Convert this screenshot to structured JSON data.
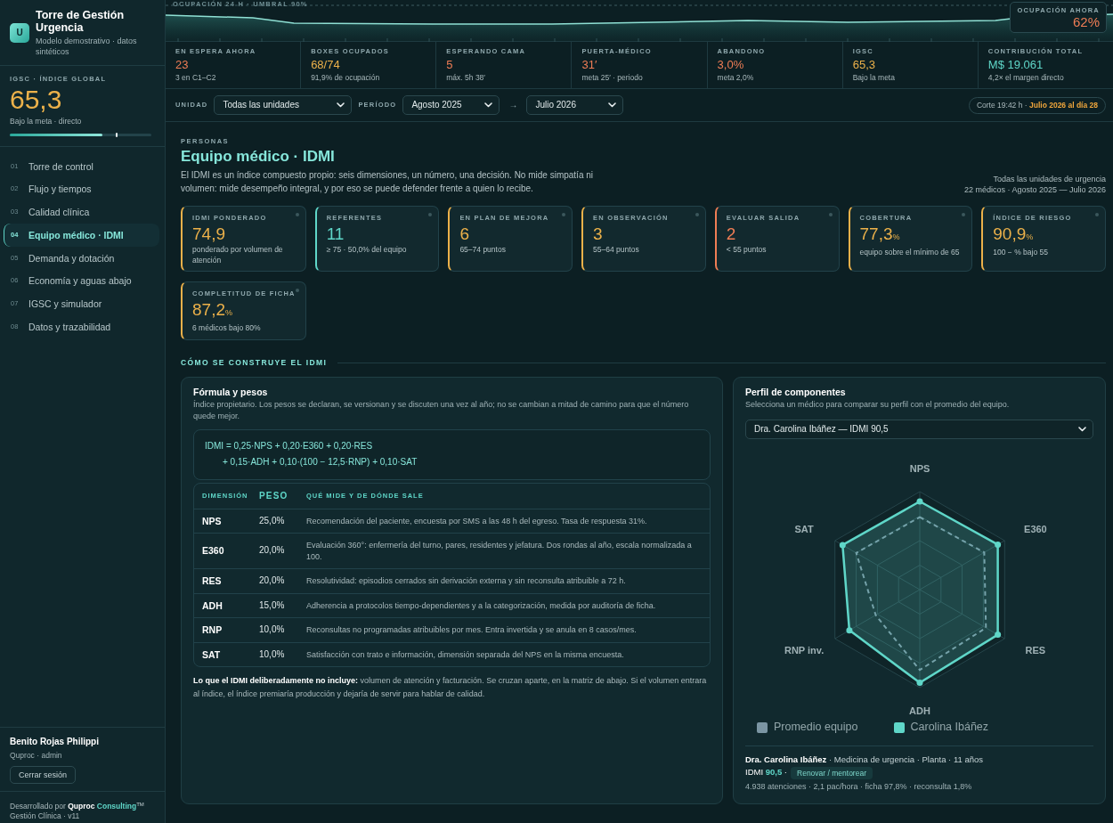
{
  "sidebar": {
    "logo": "U",
    "title": "Torre de Gestión Urgencia",
    "subtitle": "Modelo demostrativo · datos sintéticos",
    "index": {
      "label": "IGSC · ÍNDICE GLOBAL",
      "value": "65,3",
      "note": "Bajo la meta · directo",
      "level": 0.653
    },
    "nav": [
      {
        "number": "01",
        "label": "Torre de control",
        "selected": false
      },
      {
        "number": "02",
        "label": "Flujo y tiempos",
        "selected": false
      },
      {
        "number": "03",
        "label": "Calidad clínica",
        "selected": false
      },
      {
        "number": "04",
        "label": "Equipo médico · IDMI",
        "selected": true
      },
      {
        "number": "05",
        "label": "Demanda y dotación",
        "selected": false
      },
      {
        "number": "06",
        "label": "Economía y aguas abajo",
        "selected": false
      },
      {
        "number": "07",
        "label": "IGSC y simulador",
        "selected": false
      },
      {
        "number": "08",
        "label": "Datos y trazabilidad",
        "selected": false
      }
    ],
    "user": {
      "name": "Benito Rojas Philippi",
      "role": "Quproc · admin",
      "logout": "Cerrar sesión"
    },
    "credit": "Desarrollado por **Quproc** **Consulting**$^{TM}$",
    "version": "Gestión Clínica · v11"
  },
  "occupancy": {
    "title": "OCUPACIÓN 24 H · UMBRAL 90%",
    "now_label": "OCUPACIÓN AHORA",
    "now_value": "62%"
  },
  "kpis": [
    {
      "label": "EN ESPERA AHORA",
      "value": "23",
      "note": "3 en C1–C2",
      "color": "#ef7d55"
    },
    {
      "label": "BOXES OCUPADOS",
      "value": "68/74",
      "note": "91,9% de ocupación",
      "color": "#ecb14a"
    },
    {
      "label": "ESPERANDO CAMA",
      "value": "5",
      "note": "máx. 5h 38′",
      "color": "#ef7d55"
    },
    {
      "label": "PUERTA-MÉDICO",
      "value": "31′",
      "note": "meta 25′ · periodo",
      "color": "#ef7d55"
    },
    {
      "label": "ABANDONO",
      "value": "3,0%",
      "note": "meta 2,0%",
      "color": "#ef7d55"
    },
    {
      "label": "IGSC",
      "value": "65,3",
      "note": "Bajo la meta",
      "color": "#ecb14a"
    },
    {
      "label": "CONTRIBUCIÓN TOTAL",
      "value": "M$ 19.061",
      "note": "4,2× el margen directo",
      "color": "#5fd6c8"
    }
  ],
  "filters": {
    "unit_label": "UNIDAD",
    "unit": "Todas las unidades",
    "period_label": "PERÍODO",
    "from": "Agosto 2025",
    "separator": "→",
    "to": "Julio 2026",
    "cutoff": "Corte 19:42 h · **Julio 2026 al día 28**"
  },
  "page": {
    "eyebrow": "PERSONAS",
    "title": "Equipo médico · IDMI",
    "description": "El IDMI es un índice compuesto propio: seis dimensiones, un número, una decisión. No mide simpatía ni volumen: mide desempeño integral, y por eso se puede defender frente a quien lo recibe.",
    "scope": "Todas las unidades de urgencia",
    "range": "22 médicos · Agosto 2025 — Julio 2026"
  },
  "cards": [
    {
      "label": "IDMI PONDERADO",
      "value": "74,9",
      "note": "ponderado por volumen de atención",
      "color": "#ecb14a"
    },
    {
      "label": "REFERENTES",
      "value": "11",
      "note": "≥ 75 · 50,0% del equipo",
      "color": "#5fd6c8"
    },
    {
      "label": "EN PLAN DE MEJORA",
      "value": "6",
      "note": "65–74 puntos",
      "color": "#ecb14a"
    },
    {
      "label": "EN OBSERVACIÓN",
      "value": "3",
      "note": "55–64 puntos",
      "color": "#ecb14a"
    },
    {
      "label": "EVALUAR SALIDA",
      "value": "2",
      "note": "< 55 puntos",
      "color": "#ef7d55"
    },
    {
      "label": "COBERTURA",
      "value": "77,3",
      "unit": "%",
      "note": "equipo sobre el mínimo de 65",
      "color": "#ecb14a"
    },
    {
      "label": "ÍNDICE DE RIESGO",
      "value": "90,9",
      "unit": "%",
      "note": "100 − % bajo 55",
      "color": "#ecb14a"
    },
    {
      "label": "COMPLETITUD DE FICHA",
      "value": "87,2",
      "unit": "%",
      "note": "6 médicos bajo 80%",
      "color": "#ecb14a"
    }
  ],
  "construction": {
    "heading": "CÓMO SE CONSTRUYE EL IDMI",
    "formula_panel": {
      "title": "Fórmula y pesos",
      "description": "Índice propietario. Los pesos se declaran, se versionan y se discuten una vez al año; no se cambian a mitad de camino para que el número quede mejor.",
      "formula": [
        "IDMI = 0,25·NPS + 0,20·E360 + 0,20·RES",
        "+ 0,15·ADH + 0,10·(100 − 12,5·RNP) + 0,10·SAT"
      ],
      "table": {
        "columns": [
          "DIMENSIÓN",
          "PESO",
          "QUÉ MIDE Y DE DÓNDE SALE"
        ],
        "rows": [
          [
            "NPS",
            "25,0%",
            "Recomendación del paciente, encuesta por SMS a las 48 h del egreso. Tasa de respuesta 31%."
          ],
          [
            "E360",
            "20,0%",
            "Evaluación 360°: enfermería del turno, pares, residentes y jefatura. Dos rondas al año, escala normalizada a 100."
          ],
          [
            "RES",
            "20,0%",
            "Resolutividad: episodios cerrados sin derivación externa y sin reconsulta atribuible a 72 h."
          ],
          [
            "ADH",
            "15,0%",
            "Adherencia a protocolos tiempo-dependientes y a la categorización, medida por auditoría de ficha."
          ],
          [
            "RNP",
            "10,0%",
            "Reconsultas no programadas atribuibles por mes. Entra invertida y se anula en 8 casos/mes."
          ],
          [
            "SAT",
            "10,0%",
            "Satisfacción con trato e información, dimensión separada del NPS en la misma encuesta."
          ]
        ]
      },
      "footnote": "**Lo que el IDMI deliberadamente no incluye:** volumen de atención y facturación. Se cruzan aparte, en la matriz de abajo. Si el volumen entrara al índice, el índice premiaría producción y dejaría de servir para hablar de calidad."
    },
    "profile_panel": {
      "title": "Perfil de componentes",
      "description": "Selecciona un médico para comparar su perfil con el promedio del equipo.",
      "doctor_select": "Dra. Carolina Ibáñez — IDMI 90,5",
      "radar": {
        "axes": [
          "NPS",
          "E360",
          "RES",
          "ADH",
          "RNP inv.",
          "SAT"
        ]
      },
      "legend": [
        {
          "label": "Promedio equipo",
          "color": "#7b95a3"
        },
        {
          "label": "Carolina Ibáñez",
          "color": "#5fd6c8"
        }
      ],
      "detail": {
        "headline": "**Dra. Carolina Ibáñez** · Medicina de urgencia · Planta · 11 años",
        "score": "IDMI **90,5** ·",
        "tag": "Renovar / mentorear",
        "stats": "4.938 atenciones · 2,1 pac/hora · ficha 97,8% · reconsulta 1,8%"
      }
    }
  }
}
